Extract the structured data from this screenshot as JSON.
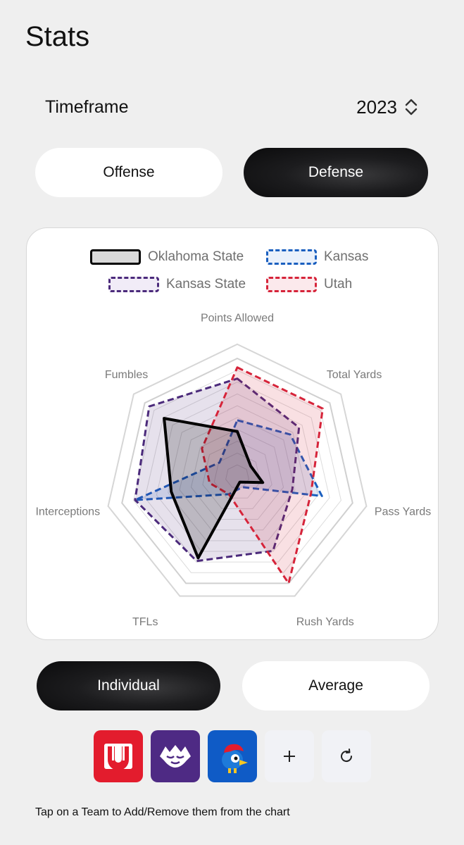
{
  "header": {
    "title": "Stats"
  },
  "timeframe": {
    "label": "Timeframe",
    "value": "2023"
  },
  "category_tabs": [
    {
      "label": "Offense",
      "selected": false
    },
    {
      "label": "Defense",
      "selected": true
    }
  ],
  "legend": [
    {
      "name": "Oklahoma State",
      "stroke": "#000000",
      "fill": "#d9d9d9",
      "style": "solid"
    },
    {
      "name": "Kansas",
      "stroke": "#1a5fbf",
      "fill": "#eaf1fb",
      "style": "dashed"
    },
    {
      "name": "Kansas State",
      "stroke": "#4b2a7b",
      "fill": "#f1ecf7",
      "style": "dashed"
    },
    {
      "name": "Utah",
      "stroke": "#d6243a",
      "fill": "#fbe9ec",
      "style": "dashed"
    }
  ],
  "chart_data": {
    "type": "radar",
    "axes": [
      "Points Allowed",
      "Total Yards",
      "Pass Yards",
      "Rush Yards",
      "TFLs",
      "Interceptions",
      "Fumbles"
    ],
    "range": [
      0,
      1
    ],
    "grid_rings": 10,
    "series": [
      {
        "name": "Oklahoma State",
        "color": "#000000",
        "values": [
          0.35,
          0.1,
          0.18,
          0.0,
          0.75,
          0.55,
          0.78
        ]
      },
      {
        "name": "Kansas",
        "color": "#1a5fbf",
        "values": [
          0.45,
          0.55,
          0.72,
          0.05,
          0.12,
          0.88,
          0.15
        ]
      },
      {
        "name": "Kansas State",
        "color": "#4b2a7b",
        "values": [
          0.82,
          0.65,
          0.45,
          0.68,
          0.78,
          0.88,
          0.95
        ]
      },
      {
        "name": "Utah",
        "color": "#d6243a",
        "values": [
          0.92,
          0.92,
          0.62,
          1.0,
          0.12,
          0.2,
          0.35
        ]
      }
    ]
  },
  "view_tabs": [
    {
      "label": "Individual",
      "selected": true
    },
    {
      "label": "Average",
      "selected": false
    }
  ],
  "teams": [
    {
      "name": "Utah",
      "icon": "utah-logo-icon",
      "color": "#e31c2d"
    },
    {
      "name": "Kansas State",
      "icon": "kansas-state-wildcat-icon",
      "color": "#4e2a84"
    },
    {
      "name": "Kansas",
      "icon": "kansas-jayhawk-icon",
      "color": "#0f5bc6"
    }
  ],
  "controls": [
    {
      "name": "add",
      "icon": "plus-icon"
    },
    {
      "name": "reset",
      "icon": "refresh-icon"
    }
  ],
  "hint": "Tap on a Team to Add/Remove them from the chart"
}
